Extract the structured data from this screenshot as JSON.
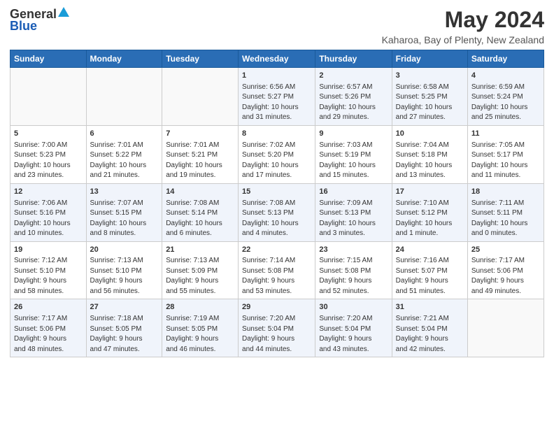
{
  "logo": {
    "line1": "General",
    "line2": "Blue"
  },
  "title": "May 2024",
  "subtitle": "Kaharoa, Bay of Plenty, New Zealand",
  "days_of_week": [
    "Sunday",
    "Monday",
    "Tuesday",
    "Wednesday",
    "Thursday",
    "Friday",
    "Saturday"
  ],
  "weeks": [
    [
      {
        "day": "",
        "detail": ""
      },
      {
        "day": "",
        "detail": ""
      },
      {
        "day": "",
        "detail": ""
      },
      {
        "day": "1",
        "detail": "Sunrise: 6:56 AM\nSunset: 5:27 PM\nDaylight: 10 hours\nand 31 minutes."
      },
      {
        "day": "2",
        "detail": "Sunrise: 6:57 AM\nSunset: 5:26 PM\nDaylight: 10 hours\nand 29 minutes."
      },
      {
        "day": "3",
        "detail": "Sunrise: 6:58 AM\nSunset: 5:25 PM\nDaylight: 10 hours\nand 27 minutes."
      },
      {
        "day": "4",
        "detail": "Sunrise: 6:59 AM\nSunset: 5:24 PM\nDaylight: 10 hours\nand 25 minutes."
      }
    ],
    [
      {
        "day": "5",
        "detail": "Sunrise: 7:00 AM\nSunset: 5:23 PM\nDaylight: 10 hours\nand 23 minutes."
      },
      {
        "day": "6",
        "detail": "Sunrise: 7:01 AM\nSunset: 5:22 PM\nDaylight: 10 hours\nand 21 minutes."
      },
      {
        "day": "7",
        "detail": "Sunrise: 7:01 AM\nSunset: 5:21 PM\nDaylight: 10 hours\nand 19 minutes."
      },
      {
        "day": "8",
        "detail": "Sunrise: 7:02 AM\nSunset: 5:20 PM\nDaylight: 10 hours\nand 17 minutes."
      },
      {
        "day": "9",
        "detail": "Sunrise: 7:03 AM\nSunset: 5:19 PM\nDaylight: 10 hours\nand 15 minutes."
      },
      {
        "day": "10",
        "detail": "Sunrise: 7:04 AM\nSunset: 5:18 PM\nDaylight: 10 hours\nand 13 minutes."
      },
      {
        "day": "11",
        "detail": "Sunrise: 7:05 AM\nSunset: 5:17 PM\nDaylight: 10 hours\nand 11 minutes."
      }
    ],
    [
      {
        "day": "12",
        "detail": "Sunrise: 7:06 AM\nSunset: 5:16 PM\nDaylight: 10 hours\nand 10 minutes."
      },
      {
        "day": "13",
        "detail": "Sunrise: 7:07 AM\nSunset: 5:15 PM\nDaylight: 10 hours\nand 8 minutes."
      },
      {
        "day": "14",
        "detail": "Sunrise: 7:08 AM\nSunset: 5:14 PM\nDaylight: 10 hours\nand 6 minutes."
      },
      {
        "day": "15",
        "detail": "Sunrise: 7:08 AM\nSunset: 5:13 PM\nDaylight: 10 hours\nand 4 minutes."
      },
      {
        "day": "16",
        "detail": "Sunrise: 7:09 AM\nSunset: 5:13 PM\nDaylight: 10 hours\nand 3 minutes."
      },
      {
        "day": "17",
        "detail": "Sunrise: 7:10 AM\nSunset: 5:12 PM\nDaylight: 10 hours\nand 1 minute."
      },
      {
        "day": "18",
        "detail": "Sunrise: 7:11 AM\nSunset: 5:11 PM\nDaylight: 10 hours\nand 0 minutes."
      }
    ],
    [
      {
        "day": "19",
        "detail": "Sunrise: 7:12 AM\nSunset: 5:10 PM\nDaylight: 9 hours\nand 58 minutes."
      },
      {
        "day": "20",
        "detail": "Sunrise: 7:13 AM\nSunset: 5:10 PM\nDaylight: 9 hours\nand 56 minutes."
      },
      {
        "day": "21",
        "detail": "Sunrise: 7:13 AM\nSunset: 5:09 PM\nDaylight: 9 hours\nand 55 minutes."
      },
      {
        "day": "22",
        "detail": "Sunrise: 7:14 AM\nSunset: 5:08 PM\nDaylight: 9 hours\nand 53 minutes."
      },
      {
        "day": "23",
        "detail": "Sunrise: 7:15 AM\nSunset: 5:08 PM\nDaylight: 9 hours\nand 52 minutes."
      },
      {
        "day": "24",
        "detail": "Sunrise: 7:16 AM\nSunset: 5:07 PM\nDaylight: 9 hours\nand 51 minutes."
      },
      {
        "day": "25",
        "detail": "Sunrise: 7:17 AM\nSunset: 5:06 PM\nDaylight: 9 hours\nand 49 minutes."
      }
    ],
    [
      {
        "day": "26",
        "detail": "Sunrise: 7:17 AM\nSunset: 5:06 PM\nDaylight: 9 hours\nand 48 minutes."
      },
      {
        "day": "27",
        "detail": "Sunrise: 7:18 AM\nSunset: 5:05 PM\nDaylight: 9 hours\nand 47 minutes."
      },
      {
        "day": "28",
        "detail": "Sunrise: 7:19 AM\nSunset: 5:05 PM\nDaylight: 9 hours\nand 46 minutes."
      },
      {
        "day": "29",
        "detail": "Sunrise: 7:20 AM\nSunset: 5:04 PM\nDaylight: 9 hours\nand 44 minutes."
      },
      {
        "day": "30",
        "detail": "Sunrise: 7:20 AM\nSunset: 5:04 PM\nDaylight: 9 hours\nand 43 minutes."
      },
      {
        "day": "31",
        "detail": "Sunrise: 7:21 AM\nSunset: 5:04 PM\nDaylight: 9 hours\nand 42 minutes."
      },
      {
        "day": "",
        "detail": ""
      }
    ]
  ]
}
